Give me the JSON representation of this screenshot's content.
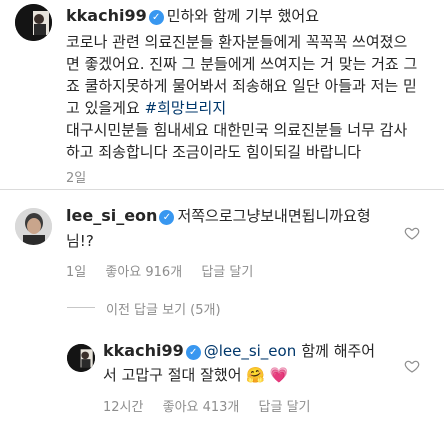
{
  "post": {
    "username": "kkachi99",
    "text_lines": [
      "민하와 함께 기부 했어요",
      "코로나 관련 의료진분들 환자분들에게 꼭꼭꼭 쓰여졌으",
      "면 좋겠어요. 진짜 그 분들에게 쓰여지는 거 맞는 거죠 그",
      "죠 쿨하지못하게 물어봐서 죄송해요 일단 아들과 저는 믿",
      "고 있을게요",
      "대구시민분들 힘내세요 대한민국 의료진분들 너무 감사",
      "하고 죄송합니다 조금이라도 힘이되길 바랍니다"
    ],
    "hashtag": "#희망브리지",
    "time": "2일"
  },
  "comment": {
    "username": "lee_si_eon",
    "text_line1": "저쪽으로그냥보내면됩니까요형",
    "text_line2": "님!?",
    "time": "1일",
    "likes": "좋아요 916개",
    "reply": "답글 달기"
  },
  "view_replies": "이전 답글 보기 (5개)",
  "reply": {
    "username": "kkachi99",
    "mention": "@lee_si_eon",
    "text_line1_after": "함께 해주어",
    "text_line2": "서 고맙구 절대 잘했어",
    "emojis": "🤗 💗",
    "time": "12시간",
    "likes": "좋아요 413개",
    "reply": "답글 달기"
  }
}
